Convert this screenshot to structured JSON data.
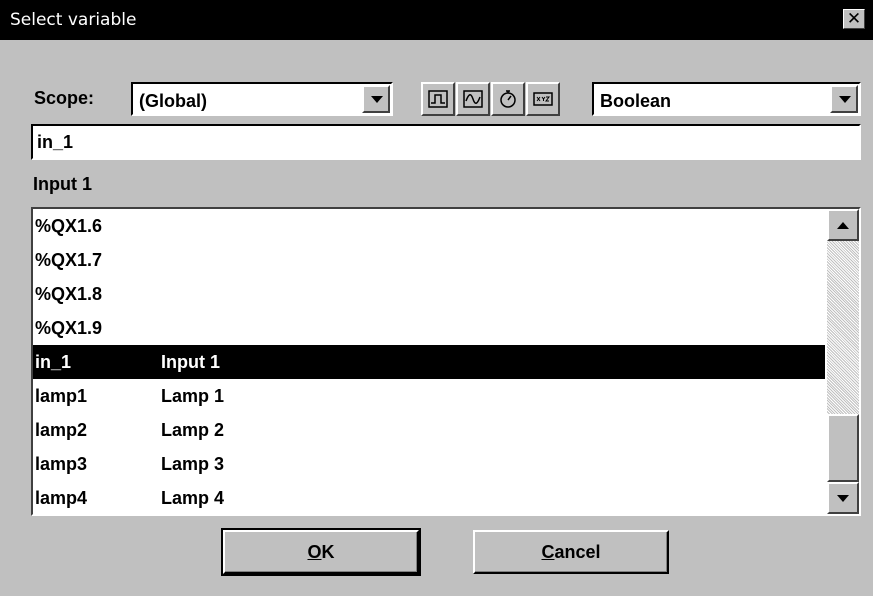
{
  "window": {
    "title": "Select variable",
    "close_glyph": "✕"
  },
  "scope": {
    "label": "Scope:",
    "value": "(Global)"
  },
  "type_filter": {
    "value": "Boolean"
  },
  "toolbar": {
    "icons": [
      "pulse-icon",
      "wave-icon",
      "timer-icon",
      "xyz-icon"
    ]
  },
  "name_input": {
    "value": "in_1"
  },
  "description": {
    "text": "Input 1"
  },
  "variables": [
    {
      "name": "%QX1.6",
      "comment": ""
    },
    {
      "name": "%QX1.7",
      "comment": ""
    },
    {
      "name": "%QX1.8",
      "comment": ""
    },
    {
      "name": "%QX1.9",
      "comment": ""
    },
    {
      "name": "in_1",
      "comment": "Input 1",
      "selected": true
    },
    {
      "name": "lamp1",
      "comment": "Lamp 1"
    },
    {
      "name": "lamp2",
      "comment": "Lamp 2"
    },
    {
      "name": "lamp3",
      "comment": "Lamp 3"
    },
    {
      "name": "lamp4",
      "comment": "Lamp 4"
    }
  ],
  "buttons": {
    "ok": {
      "mnemonic": "O",
      "rest": "K"
    },
    "cancel": {
      "mnemonic": "C",
      "rest": "ancel"
    }
  }
}
